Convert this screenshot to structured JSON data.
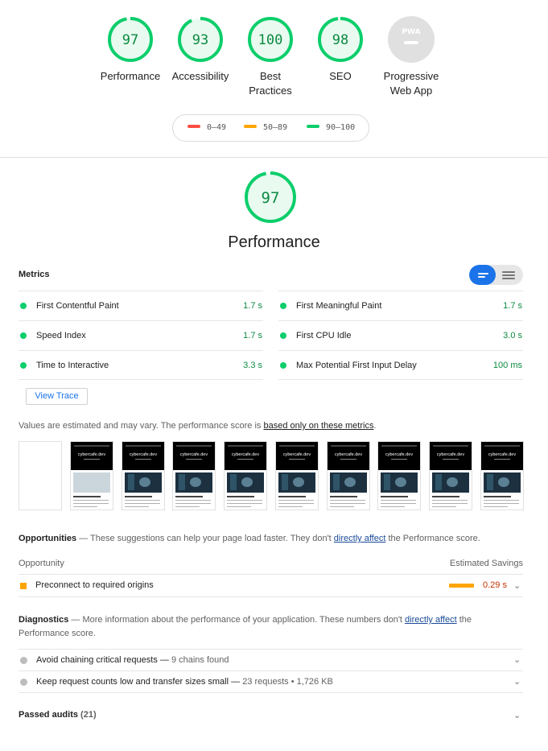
{
  "categories": [
    {
      "label": "97",
      "name": "Performance",
      "score": 0.97
    },
    {
      "label": "93",
      "name": "Accessibility",
      "score": 0.93
    },
    {
      "label": "100",
      "name": "Best Practices",
      "score": 1.0
    },
    {
      "label": "98",
      "name": "SEO",
      "score": 0.98
    },
    {
      "label": "PWA",
      "name": "Progressive Web App",
      "score": null
    }
  ],
  "legend": [
    {
      "range": "0–49",
      "color": "#ff4e42"
    },
    {
      "range": "50–89",
      "color": "#ffa400"
    },
    {
      "range": "90–100",
      "color": "#0cce6b"
    }
  ],
  "performance": {
    "score_text": "97",
    "score": 0.97,
    "title": "Performance"
  },
  "metrics": {
    "heading": "Metrics",
    "left": [
      {
        "name": "First Contentful Paint",
        "value": "1.7 s"
      },
      {
        "name": "Speed Index",
        "value": "1.7 s"
      },
      {
        "name": "Time to Interactive",
        "value": "3.3 s"
      }
    ],
    "right": [
      {
        "name": "First Meaningful Paint",
        "value": "1.7 s"
      },
      {
        "name": "First CPU Idle",
        "value": "3.0 s"
      },
      {
        "name": "Max Potential First Input Delay",
        "value": "100 ms"
      }
    ]
  },
  "view_trace": "View Trace",
  "note": {
    "text": "Values are estimated and may vary. The performance score is ",
    "link": "based only on these metrics",
    "end": "."
  },
  "filmstrip": {
    "site_title": "cybercafe.dev"
  },
  "opportunities": {
    "title": "Opportunities",
    "desc": " — These suggestions can help your page load faster. They don't ",
    "link": "directly affect",
    "desc_end": " the Performance score.",
    "col_left": "Opportunity",
    "col_right": "Estimated Savings",
    "items": [
      {
        "name": "Preconnect to required origins",
        "value": "0.29 s"
      }
    ]
  },
  "diagnostics": {
    "title": "Diagnostics",
    "desc": " — More information about the performance of your application. These numbers don't ",
    "link": "directly affect",
    "desc_end": " the Performance score.",
    "items": [
      {
        "name": "Avoid chaining critical requests",
        "detail": "9 chains found"
      },
      {
        "name": "Keep request counts low and transfer sizes small",
        "detail": "23 requests • 1,726 KB"
      }
    ]
  },
  "passed": {
    "label": "Passed audits",
    "count": "(21)"
  }
}
